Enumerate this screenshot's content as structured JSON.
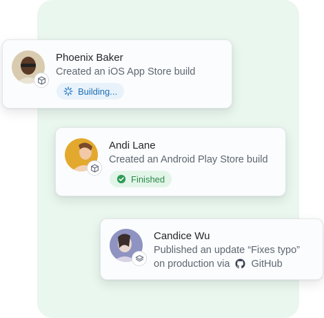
{
  "cards": [
    {
      "name": "Phoenix Baker",
      "description": "Created an iOS App Store build",
      "status": "Building...",
      "status_icon": "spinner-icon",
      "badge_icon": "cube-icon"
    },
    {
      "name": "Andi Lane",
      "description": "Created an Android Play Store build",
      "status": "Finished",
      "status_icon": "check-circle-icon",
      "badge_icon": "cube-icon"
    },
    {
      "name": "Candice Wu",
      "description_line1": "Published an update “Fixes typo”",
      "description_line2_prefix": "on production via",
      "link_label": "GitHub",
      "link_icon": "github-icon",
      "badge_icon": "layers-icon"
    }
  ],
  "colors": {
    "panel_bg": "#e9f7ee",
    "building_fg": "#1f6fb5",
    "finished_fg": "#2a8a4a"
  }
}
